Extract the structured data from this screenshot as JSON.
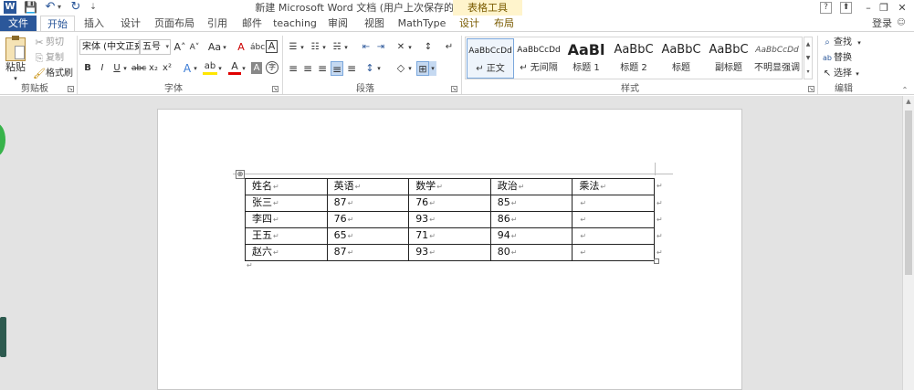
{
  "window": {
    "title": "新建 Microsoft Word 文档 (用户上次保存的) - Word",
    "context_group": "表格工具",
    "help": "?",
    "minimize": "–",
    "restore": "❐",
    "close": "✕",
    "login": "登录"
  },
  "quick_access": {
    "word_icon": "W",
    "save": "💾",
    "undo": "↶",
    "undo_drop": "▾",
    "redo": "↻",
    "customize": "⇣"
  },
  "tabs": [
    {
      "label": "文件"
    },
    {
      "label": "开始"
    },
    {
      "label": "插入"
    },
    {
      "label": "设计"
    },
    {
      "label": "页面布局"
    },
    {
      "label": "引用"
    },
    {
      "label": "邮件"
    },
    {
      "label": "teaching"
    },
    {
      "label": "审阅"
    },
    {
      "label": "视图"
    },
    {
      "label": "MathType"
    },
    {
      "label": "设计"
    },
    {
      "label": "布局"
    }
  ],
  "ribbon": {
    "clipboard": {
      "paste": "粘贴",
      "cut": "剪切",
      "copy": "复制",
      "format_painter": "格式刷",
      "label": "剪贴板"
    },
    "font": {
      "font_name": "宋体 (中文正文",
      "font_size": "五号",
      "grow": "A˄",
      "shrink": "A˅",
      "change_case": "Aa",
      "clear_format": "A",
      "phonetic": "ábc",
      "char_border": "A",
      "bold": "B",
      "italic": "I",
      "underline": "U",
      "strikethrough": "abc",
      "subscript": "x₂",
      "superscript": "x²",
      "text_effect": "A",
      "highlight": "ab",
      "font_color": "A",
      "char_shading": "A",
      "enclosed": "字",
      "label": "字体"
    },
    "paragraph": {
      "bullets": "☰",
      "numbering": "☷",
      "multilevel": "☵",
      "decrease_indent": "⇤",
      "increase_indent": "⇥",
      "chinese_layout": "✕",
      "sort": "↕",
      "show_marks": "↵",
      "align_left": "≡",
      "center": "≡",
      "align_right": "≡",
      "justify": "≡",
      "distributed": "≡",
      "line_spacing": "↕",
      "shading": "◇",
      "borders": "⊞",
      "label": "段落"
    },
    "styles": {
      "items": [
        {
          "sample": "AaBbCcDd",
          "name": "↵ 正文"
        },
        {
          "sample": "AaBbCcDd",
          "name": "↵ 无间隔"
        },
        {
          "sample": "AaBl",
          "name": "标题 1"
        },
        {
          "sample": "AaBbC",
          "name": "标题 2"
        },
        {
          "sample": "AaBbC",
          "name": "标题"
        },
        {
          "sample": "AaBbC",
          "name": "副标题"
        },
        {
          "sample": "AaBbCcDd",
          "name": "不明显强调"
        }
      ],
      "label": "样式"
    },
    "editing": {
      "find": "查找",
      "replace": "替换",
      "select": "选择",
      "label": "编辑"
    }
  },
  "table": {
    "headers": [
      "姓名",
      "英语",
      "数学",
      "政治",
      "乘法"
    ],
    "rows": [
      [
        "张三",
        "87",
        "76",
        "85",
        ""
      ],
      [
        "李四",
        "76",
        "93",
        "86",
        ""
      ],
      [
        "王五",
        "65",
        "71",
        "94",
        ""
      ],
      [
        "赵六",
        "87",
        "93",
        "80",
        ""
      ]
    ],
    "paragraph_mark": "↵",
    "move_handle": "⊕"
  },
  "colors": {
    "accent": "#2b579a",
    "context_tab_bg": "#fff4cc",
    "context_tab_text": "#7a5b00",
    "workspace": "#e3e3e3"
  }
}
